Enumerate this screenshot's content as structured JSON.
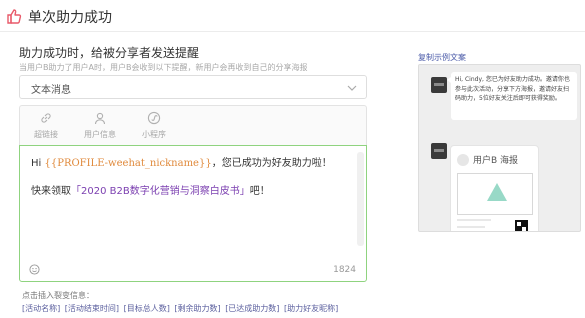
{
  "header": {
    "title": "单次助力成功"
  },
  "form": {
    "label": "助力成功时，给被分享者发送提醒",
    "hint": "当用户B助力了用户A时，用户B会收到以下提醒，新用户会再收到自己的分享海报",
    "message_type": "文本消息"
  },
  "toolbar": {
    "items": [
      {
        "label": "超链接",
        "icon": "link-icon"
      },
      {
        "label": "用户信息",
        "icon": "user-icon"
      },
      {
        "label": "小程序",
        "icon": "mini-program-icon"
      }
    ]
  },
  "editor": {
    "line1_prefix": "Hi ",
    "line1_tag": "{{PROFILE-weehat_nickname}}",
    "line1_suffix": "，您已成功为好友助力啦！",
    "line2_prefix": "快来领取",
    "line2_tag": "「2020 B2B数字化营销与洞察白皮书」",
    "line2_suffix": "吧！",
    "char_count": "1824"
  },
  "insert": {
    "label": "点击插入裂变信息：",
    "tags": [
      "[活动名称]",
      "[活动结束时间]",
      "[目标总人数]",
      "[剩余助力数]",
      "[已达成助力数]",
      "[助力好友昵称]"
    ]
  },
  "preview": {
    "link_label": "复制示例文案",
    "bubble_text": "Hi, Cindy, 您已为好友助力成功。邀请你也参与此次活动，分享下方海报，邀请好友扫码助力，5位好友关注后即可获得奖励。",
    "poster_title": "用户B 海报"
  },
  "colors": {
    "accent_green": "#8fd37f",
    "link_blue": "#4a5aa8",
    "header_icon": "#e85a6a",
    "tag_orange": "#e08a3c",
    "tag_purple": "#7b3fb0"
  }
}
